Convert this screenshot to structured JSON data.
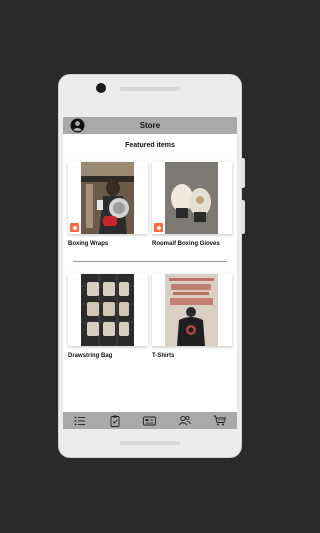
{
  "app_bar": {
    "title": "Store"
  },
  "section": {
    "title": "Featured items"
  },
  "products": [
    {
      "label": "Boxing Wraps"
    },
    {
      "label": "Roomaif Boxing Gloves"
    },
    {
      "label": "Drawstring Bag"
    },
    {
      "label": "T-Shirts"
    }
  ],
  "colors": {
    "bar": "#a9a9a9",
    "badge": "#ff6a3d",
    "background": "#2a2a2a"
  },
  "icons": {
    "account": "account-circle-icon",
    "badge": "sale-tag-icon",
    "nav": [
      "list-icon",
      "clipboard-icon",
      "card-icon",
      "people-icon",
      "cart-icon"
    ]
  }
}
